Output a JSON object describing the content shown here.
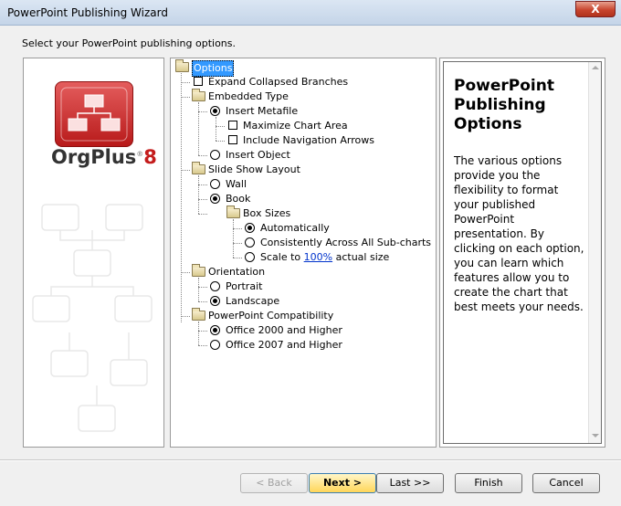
{
  "window": {
    "title": "PowerPoint Publishing Wizard",
    "close_glyph": "X"
  },
  "instruction": "Select your PowerPoint publishing options.",
  "logo": {
    "brand": "OrgPlus",
    "version": "8"
  },
  "tree": {
    "options": "Options",
    "expand_collapsed": "Expand Collapsed Branches",
    "embedded_type": "Embedded Type",
    "insert_metafile": "Insert Metafile",
    "maximize_chart": "Maximize Chart Area",
    "include_nav": "Include Navigation Arrows",
    "insert_object": "Insert Object",
    "slide_show_layout": "Slide Show Layout",
    "wall": "Wall",
    "book": "Book",
    "box_sizes": "Box Sizes",
    "automatically": "Automatically",
    "consistently": "Consistently Across All Sub-charts",
    "scale_to": "Scale to",
    "scale_value": "100%",
    "actual_size": "actual size",
    "orientation": "Orientation",
    "portrait": "Portrait",
    "landscape": "Landscape",
    "compatibility": "PowerPoint Compatibility",
    "office2000": "Office 2000 and Higher",
    "office2007": "Office 2007 and Higher"
  },
  "description": {
    "title": "PowerPoint Publishing Options",
    "body": "The various options provide you the flexibility to format your published PowerPoint presentation. By clicking on each option, you can learn which features allow you to create the chart that best meets your needs."
  },
  "buttons": {
    "back": "< Back",
    "next": "Next >",
    "last": "Last >>",
    "finish": "Finish",
    "cancel": "Cancel"
  },
  "colors": {
    "selection": "#3399ff",
    "brand_red": "#c41c1c"
  }
}
